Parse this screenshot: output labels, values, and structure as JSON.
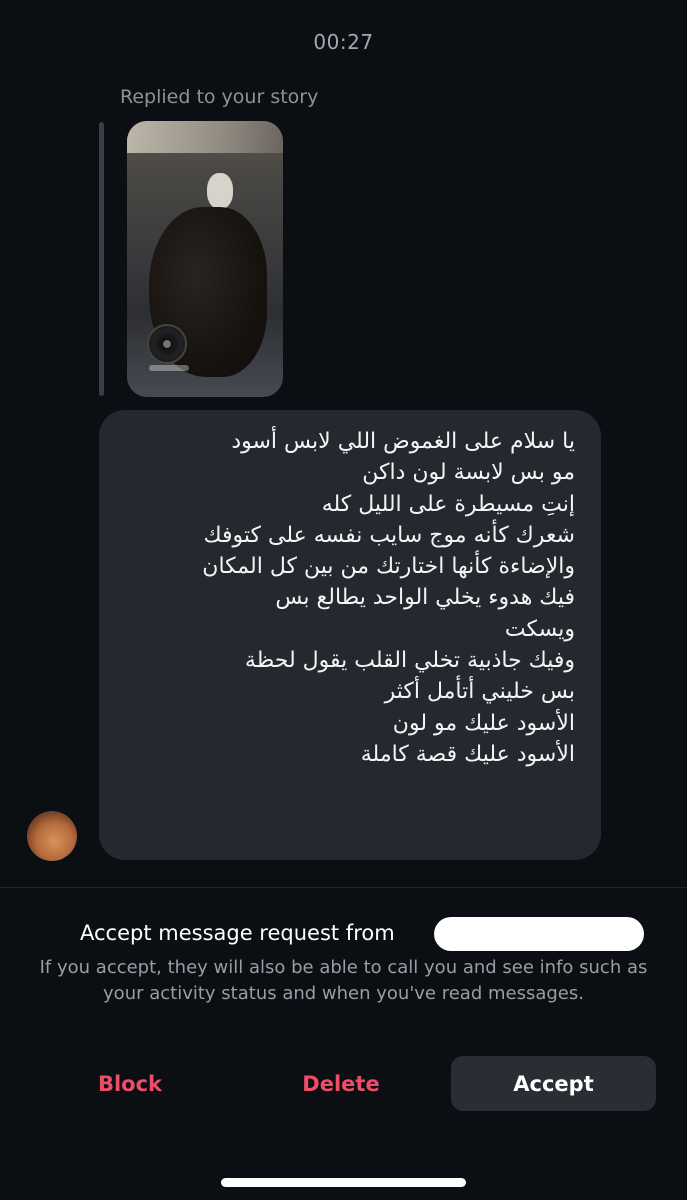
{
  "header": {
    "timestamp": "00:27"
  },
  "story_reply": {
    "label": "Replied to your story",
    "thumbnail_icon": "story-photo"
  },
  "message": {
    "lines": [
      "يا سلام على الغموض اللي لابس أسود",
      "مو بس لابسة لون داكن",
      "إنتِ مسيطرة على الليل كله",
      "شعرك كأنه موج سايب نفسه على كتوفك",
      "والإضاءة كأنها اختارتك من بين كل المكان",
      "فيك هدوء يخلي الواحد يطالع بس",
      "ويسكت",
      "وفيك جاذبية تخلي القلب يقول لحظة",
      "بس خليني أتأمل أكثر",
      "الأسود عليك مو لون",
      "الأسود عليك قصة كاملة"
    ]
  },
  "request": {
    "title": "Accept message request from",
    "description": "If you accept, they will also be able to call you and see info such as your activity status and when you've read messages."
  },
  "actions": {
    "block_label": "Block",
    "delete_label": "Delete",
    "accept_label": "Accept"
  },
  "colors": {
    "background": "#0b0e12",
    "bubble": "#25282e",
    "destructive": "#ee4d67",
    "accept_button": "#2a2d33"
  }
}
